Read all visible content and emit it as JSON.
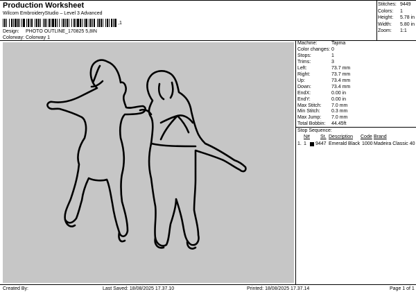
{
  "header": {
    "title": "Production Worksheet",
    "subtitle": "Wilcom EmbroideryStudio – Level 3 Advanced",
    "barcode_tail": ",1",
    "design_label": "Design:",
    "design_value": "PHOTO OUTLINE_170825 5,8IN",
    "colorway_label": "Colorway:",
    "colorway_value": "Colorway 1"
  },
  "stats": [
    {
      "label": "Stitches:",
      "value": "9449"
    },
    {
      "label": "Colors:",
      "value": "1"
    },
    {
      "label": "Height:",
      "value": "5.78 in"
    },
    {
      "label": "Width:",
      "value": "5.80 in"
    },
    {
      "label": "Zoom:",
      "value": "1:1"
    }
  ],
  "properties": [
    {
      "label": "Machine:",
      "value": "Tajima"
    },
    {
      "label": "Color changes:",
      "value": "0"
    },
    {
      "label": "Stops:",
      "value": "1"
    },
    {
      "label": "Trims:",
      "value": "3"
    },
    {
      "label": "Left:",
      "value": "73.7 mm"
    },
    {
      "label": "Right:",
      "value": "73.7 mm"
    },
    {
      "label": "Up:",
      "value": "73.4 mm"
    },
    {
      "label": "Down:",
      "value": "73.4 mm"
    },
    {
      "label": "EndX:",
      "value": "0.00 in"
    },
    {
      "label": "EndY:",
      "value": "0.00 in"
    },
    {
      "label": "Max Stitch:",
      "value": "7.0 mm"
    },
    {
      "label": "Min Stitch:",
      "value": "0.3 mm"
    },
    {
      "label": "Max Jump:",
      "value": "7.0 mm"
    },
    {
      "label": "Total Bobbin:",
      "value": "44.45ft"
    }
  ],
  "stop_sequence": {
    "title": "Stop Sequence:",
    "headers": [
      "N#",
      "St.",
      "Description",
      "Code",
      "Brand"
    ],
    "rows": [
      {
        "seq": "1.",
        "n": "1",
        "color": "#000000",
        "stitches": "9447",
        "description": "Emerald Black",
        "code": "1000",
        "brand": "Madeira Classic 40"
      }
    ]
  },
  "footer": {
    "created_by": "Created By:",
    "last_saved": "Last Saved: 18/08/2025 17.37.10",
    "printed": "Printed: 18/08/2025 17.37.14",
    "page": "Page 1 of 1"
  },
  "design_preview": {
    "background_color": "#c6c6c6",
    "stitch_color": "#000000"
  }
}
